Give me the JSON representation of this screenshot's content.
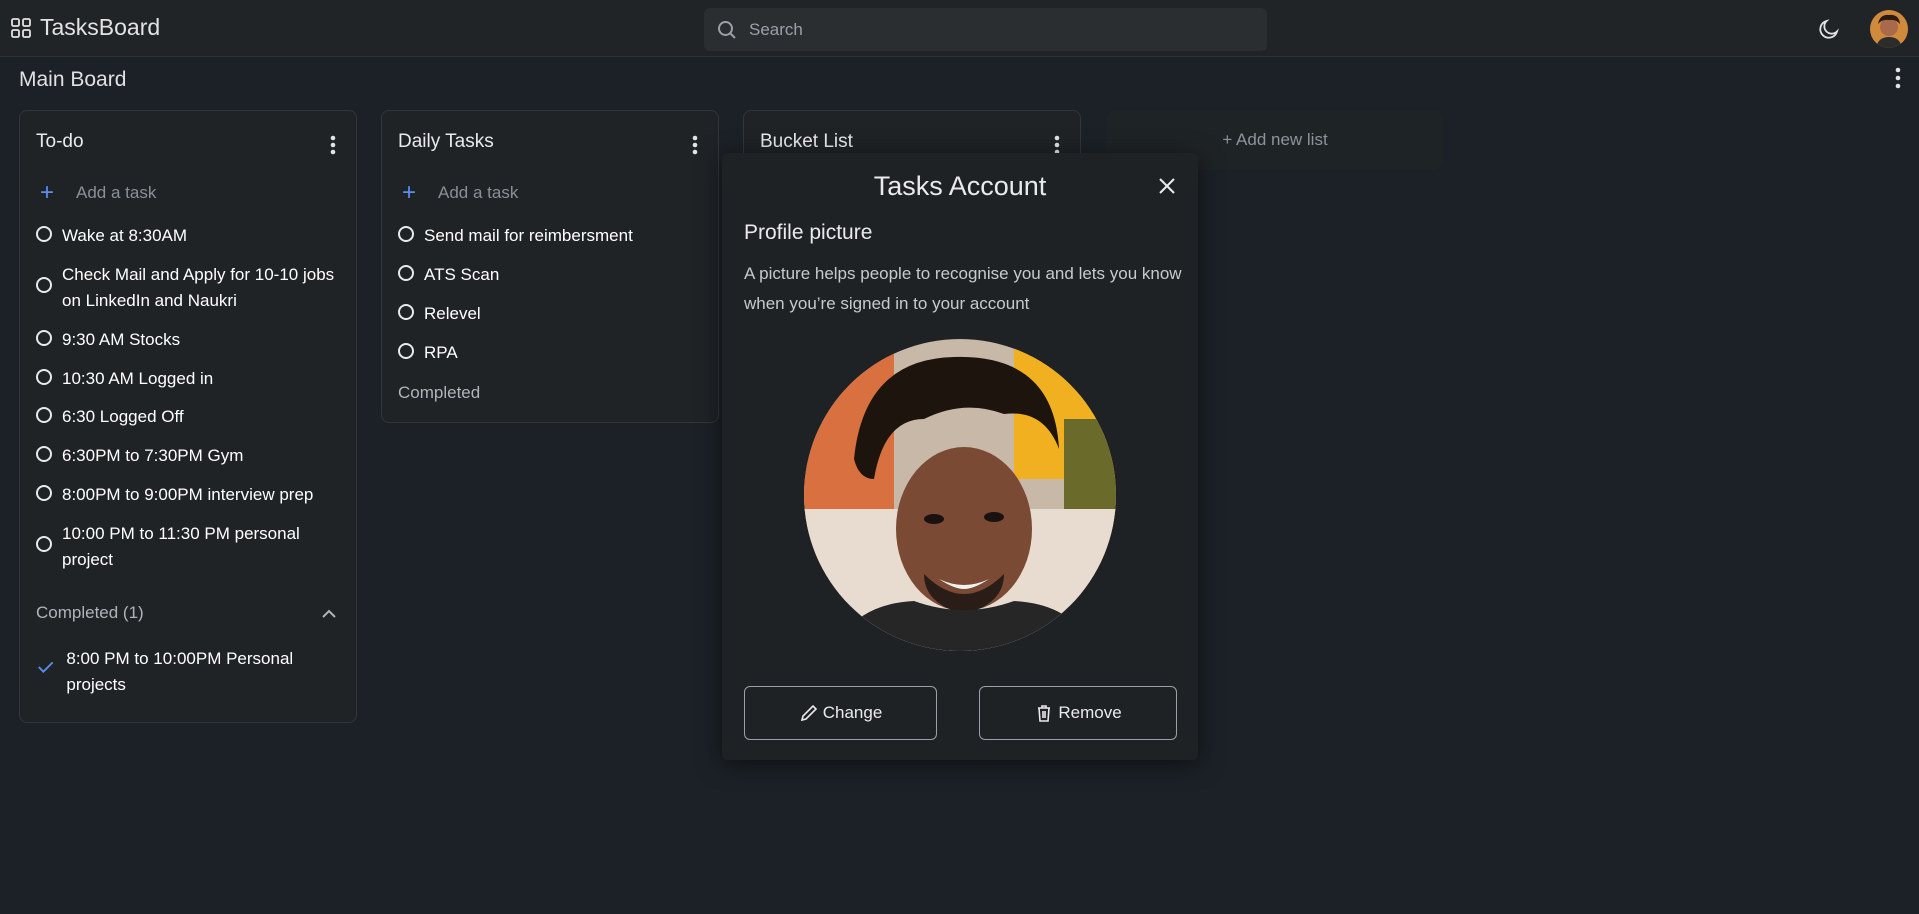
{
  "header": {
    "app_title": "TasksBoard",
    "search_placeholder": "Search",
    "theme_icon": "moon-icon",
    "grid_icon": "apps-grid-icon"
  },
  "board": {
    "title": "Main Board"
  },
  "lists": [
    {
      "title": "To-do",
      "add_label": "Add a task",
      "tasks": [
        "Wake at 8:30AM",
        "Check Mail and Apply for 10-10 jobs on LinkedIn and Naukri",
        "9:30 AM Stocks",
        "10:30 AM Logged in",
        "6:30 Logged Off",
        "6:30PM to 7:30PM Gym",
        "8:00PM to 9:00PM interview prep",
        "10:00 PM to 11:30 PM personal project"
      ],
      "completed_label": "Completed (1)",
      "completed_tasks": [
        "8:00 PM to 10:00PM Personal projects"
      ]
    },
    {
      "title": "Daily Tasks",
      "add_label": "Add a task",
      "tasks": [
        "Send mail for reimbersment",
        "ATS Scan",
        "Relevel",
        "RPA"
      ],
      "completed_label": "Completed"
    },
    {
      "title": "Bucket List"
    }
  ],
  "add_list_label": "+ Add new list",
  "modal": {
    "title": "Tasks Account",
    "subtitle": "Profile picture",
    "description": "A picture helps people to recognise you and lets you know when you’re signed in to your account",
    "change_label": "Change",
    "remove_label": "Remove"
  },
  "colors": {
    "background": "#1b2126",
    "accent": "#5b8def",
    "card": "#1f2326"
  }
}
